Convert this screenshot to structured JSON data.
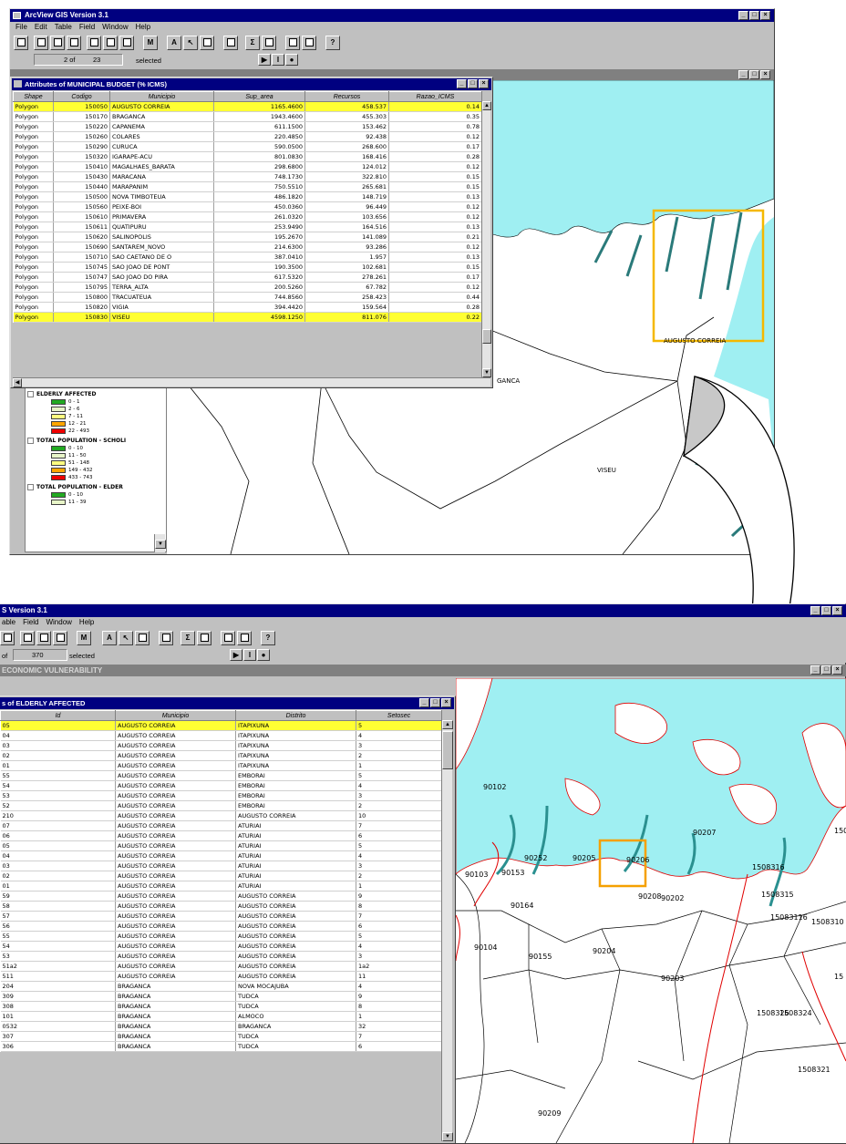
{
  "colors": {
    "title_bar": "#000080",
    "selection": "#ffff33",
    "water": "#9feff2",
    "highlight_box": "#f5b800",
    "map_line_red": "#e00000"
  },
  "top": {
    "app_title": "ArcView GIS Version 3.1",
    "menu": [
      "File",
      "Edit",
      "Table",
      "Field",
      "Window",
      "Help"
    ],
    "status": {
      "selected_count": "2",
      "of_label": "of",
      "total": "23",
      "selected_label": "selected"
    },
    "table": {
      "title": "Attributes of MUNICIPAL BUDGET (% ICMS)",
      "columns": [
        "Shape",
        "Codigo",
        "Municipio",
        "Sup_area",
        "Recursos",
        "Razao_ICMS"
      ],
      "rows": [
        {
          "shape": "Polygon",
          "codigo": "150050",
          "municipio": "AUGUSTO CORREIA",
          "area": "1165.4600",
          "recursos": "458.537",
          "razao": "0.14",
          "sel": true
        },
        {
          "shape": "Polygon",
          "codigo": "150170",
          "municipio": "BRAGANCA",
          "area": "1943.4600",
          "recursos": "455.303",
          "razao": "0.35",
          "sel": false
        },
        {
          "shape": "Polygon",
          "codigo": "150220",
          "municipio": "CAPANEMA",
          "area": "611.1500",
          "recursos": "153.462",
          "razao": "0.78",
          "sel": false
        },
        {
          "shape": "Polygon",
          "codigo": "150260",
          "municipio": "COLARES",
          "area": "220.4850",
          "recursos": "92.438",
          "razao": "0.12",
          "sel": false
        },
        {
          "shape": "Polygon",
          "codigo": "150290",
          "municipio": "CURUCA",
          "area": "590.0500",
          "recursos": "268.600",
          "razao": "0.17",
          "sel": false
        },
        {
          "shape": "Polygon",
          "codigo": "150320",
          "municipio": "IGARAPE-ACU",
          "area": "801.0830",
          "recursos": "168.416",
          "razao": "0.28",
          "sel": false
        },
        {
          "shape": "Polygon",
          "codigo": "150410",
          "municipio": "MAGALHAES_BARATA",
          "area": "298.6800",
          "recursos": "124.012",
          "razao": "0.12",
          "sel": false
        },
        {
          "shape": "Polygon",
          "codigo": "150430",
          "municipio": "MARACANA",
          "area": "748.1730",
          "recursos": "322.810",
          "razao": "0.15",
          "sel": false
        },
        {
          "shape": "Polygon",
          "codigo": "150440",
          "municipio": "MARAPANIM",
          "area": "750.5510",
          "recursos": "265.681",
          "razao": "0.15",
          "sel": false
        },
        {
          "shape": "Polygon",
          "codigo": "150500",
          "municipio": "NOVA TIMBOTEUA",
          "area": "486.1820",
          "recursos": "148.719",
          "razao": "0.13",
          "sel": false
        },
        {
          "shape": "Polygon",
          "codigo": "150560",
          "municipio": "PEIXE-BOI",
          "area": "450.0360",
          "recursos": "96.449",
          "razao": "0.12",
          "sel": false
        },
        {
          "shape": "Polygon",
          "codigo": "150610",
          "municipio": "PRIMAVERA",
          "area": "261.0320",
          "recursos": "103.656",
          "razao": "0.12",
          "sel": false
        },
        {
          "shape": "Polygon",
          "codigo": "150611",
          "municipio": "QUATIPURU",
          "area": "253.9490",
          "recursos": "164.516",
          "razao": "0.13",
          "sel": false
        },
        {
          "shape": "Polygon",
          "codigo": "150620",
          "municipio": "SALINOPOLIS",
          "area": "195.2670",
          "recursos": "141.089",
          "razao": "0.21",
          "sel": false
        },
        {
          "shape": "Polygon",
          "codigo": "150690",
          "municipio": "SANTAREM_NOVO",
          "area": "214.6300",
          "recursos": "93.286",
          "razao": "0.12",
          "sel": false
        },
        {
          "shape": "Polygon",
          "codigo": "150710",
          "municipio": "SAO CAETANO DE O",
          "area": "387.0410",
          "recursos": "1.957",
          "razao": "0.13",
          "sel": false
        },
        {
          "shape": "Polygon",
          "codigo": "150745",
          "municipio": "SAO JOAO DE PONT",
          "area": "190.3500",
          "recursos": "102.681",
          "razao": "0.15",
          "sel": false
        },
        {
          "shape": "Polygon",
          "codigo": "150747",
          "municipio": "SAO JOAO DO PIRA",
          "area": "617.5320",
          "recursos": "278.261",
          "razao": "0.17",
          "sel": false
        },
        {
          "shape": "Polygon",
          "codigo": "150795",
          "municipio": "TERRA_ALTA",
          "area": "200.5260",
          "recursos": "67.782",
          "razao": "0.12",
          "sel": false
        },
        {
          "shape": "Polygon",
          "codigo": "150800",
          "municipio": "TRACUATEUA",
          "area": "744.8560",
          "recursos": "258.423",
          "razao": "0.44",
          "sel": false
        },
        {
          "shape": "Polygon",
          "codigo": "150820",
          "municipio": "VIGIA",
          "area": "394.4420",
          "recursos": "159.564",
          "razao": "0.28",
          "sel": false
        },
        {
          "shape": "Polygon",
          "codigo": "150830",
          "municipio": "VISEU",
          "area": "4598.1250",
          "recursos": "811.076",
          "razao": "0.22",
          "sel": true
        }
      ]
    },
    "legend": {
      "groups": [
        {
          "title": "ELDERLY AFFECTED",
          "items": [
            {
              "label": "0 - 1",
              "color": "#22aa22"
            },
            {
              "label": "2 - 6",
              "color": "#e8f5c8"
            },
            {
              "label": "7 - 11",
              "color": "#ffff80"
            },
            {
              "label": "12 - 21",
              "color": "#ffa500"
            },
            {
              "label": "22 - 493",
              "color": "#ee0000"
            }
          ]
        },
        {
          "title": "TOTAL POPULATION - SCHOLI",
          "items": [
            {
              "label": "0 - 10",
              "color": "#22aa22"
            },
            {
              "label": "11 - 50",
              "color": "#e8f5c8"
            },
            {
              "label": "51 - 148",
              "color": "#ffff80"
            },
            {
              "label": "149 - 432",
              "color": "#ffa500"
            },
            {
              "label": "433 - 743",
              "color": "#ee0000"
            }
          ]
        },
        {
          "title": "TOTAL POPULATION - ELDER",
          "items": [
            {
              "label": "0 - 10",
              "color": "#22aa22"
            },
            {
              "label": "11 - 39",
              "color": "#e8f5c8"
            }
          ]
        }
      ]
    },
    "map_labels": [
      "AUGUSTO CORREIA",
      "VISEU",
      "GANCA"
    ]
  },
  "bottom": {
    "app_title": "S Version 3.1",
    "menu": [
      "able",
      "Field",
      "Window",
      "Help"
    ],
    "status": {
      "of_label": "of",
      "total": "370",
      "selected_label": "selected"
    },
    "view_title": "ECONOMIC VULNERABILITY",
    "table": {
      "title": "s of ELDERLY AFFECTED",
      "columns": [
        "Id",
        "Municipio",
        "Distrito",
        "Setosec"
      ],
      "rows": [
        {
          "id": "05",
          "municipio": "AUGUSTO CORREIA",
          "distrito": "ITAPIXUNA",
          "setor": "5",
          "sel": true
        },
        {
          "id": "04",
          "municipio": "AUGUSTO CORREIA",
          "distrito": "ITAPIXUNA",
          "setor": "4",
          "sel": false
        },
        {
          "id": "03",
          "municipio": "AUGUSTO CORREIA",
          "distrito": "ITAPIXUNA",
          "setor": "3",
          "sel": false
        },
        {
          "id": "02",
          "municipio": "AUGUSTO CORREIA",
          "distrito": "ITAPIXUNA",
          "setor": "2",
          "sel": false
        },
        {
          "id": "01",
          "municipio": "AUGUSTO CORREIA",
          "distrito": "ITAPIXUNA",
          "setor": "1",
          "sel": false
        },
        {
          "id": "55",
          "municipio": "AUGUSTO CORREIA",
          "distrito": "EMBORAI",
          "setor": "5",
          "sel": false
        },
        {
          "id": "54",
          "municipio": "AUGUSTO CORREIA",
          "distrito": "EMBORAI",
          "setor": "4",
          "sel": false
        },
        {
          "id": "53",
          "municipio": "AUGUSTO CORREIA",
          "distrito": "EMBORAI",
          "setor": "3",
          "sel": false
        },
        {
          "id": "52",
          "municipio": "AUGUSTO CORREIA",
          "distrito": "EMBORAI",
          "setor": "2",
          "sel": false
        },
        {
          "id": "210",
          "municipio": "AUGUSTO CORREIA",
          "distrito": "AUGUSTO CORREIA",
          "setor": "10",
          "sel": false
        },
        {
          "id": "07",
          "municipio": "AUGUSTO CORREIA",
          "distrito": "ATURIAI",
          "setor": "7",
          "sel": false
        },
        {
          "id": "06",
          "municipio": "AUGUSTO CORREIA",
          "distrito": "ATURIAI",
          "setor": "6",
          "sel": false
        },
        {
          "id": "05",
          "municipio": "AUGUSTO CORREIA",
          "distrito": "ATURIAI",
          "setor": "5",
          "sel": false
        },
        {
          "id": "04",
          "municipio": "AUGUSTO CORREIA",
          "distrito": "ATURIAI",
          "setor": "4",
          "sel": false
        },
        {
          "id": "03",
          "municipio": "AUGUSTO CORREIA",
          "distrito": "ATURIAI",
          "setor": "3",
          "sel": false
        },
        {
          "id": "02",
          "municipio": "AUGUSTO CORREIA",
          "distrito": "ATURIAI",
          "setor": "2",
          "sel": false
        },
        {
          "id": "01",
          "municipio": "AUGUSTO CORREIA",
          "distrito": "ATURIAI",
          "setor": "1",
          "sel": false
        },
        {
          "id": "59",
          "municipio": "AUGUSTO CORREIA",
          "distrito": "AUGUSTO CORREIA",
          "setor": "9",
          "sel": false
        },
        {
          "id": "58",
          "municipio": "AUGUSTO CORREIA",
          "distrito": "AUGUSTO CORREIA",
          "setor": "8",
          "sel": false
        },
        {
          "id": "57",
          "municipio": "AUGUSTO CORREIA",
          "distrito": "AUGUSTO CORREIA",
          "setor": "7",
          "sel": false
        },
        {
          "id": "56",
          "municipio": "AUGUSTO CORREIA",
          "distrito": "AUGUSTO CORREIA",
          "setor": "6",
          "sel": false
        },
        {
          "id": "55",
          "municipio": "AUGUSTO CORREIA",
          "distrito": "AUGUSTO CORREIA",
          "setor": "5",
          "sel": false
        },
        {
          "id": "54",
          "municipio": "AUGUSTO CORREIA",
          "distrito": "AUGUSTO CORREIA",
          "setor": "4",
          "sel": false
        },
        {
          "id": "53",
          "municipio": "AUGUSTO CORREIA",
          "distrito": "AUGUSTO CORREIA",
          "setor": "3",
          "sel": false
        },
        {
          "id": "51a2",
          "municipio": "AUGUSTO CORREIA",
          "distrito": "AUGUSTO CORREIA",
          "setor": "1a2",
          "sel": false
        },
        {
          "id": "511",
          "municipio": "AUGUSTO CORREIA",
          "distrito": "AUGUSTO CORREIA",
          "setor": "11",
          "sel": false
        },
        {
          "id": "204",
          "municipio": "BRAGANCA",
          "distrito": "NOVA MOCAJUBA",
          "setor": "4",
          "sel": false
        },
        {
          "id": "309",
          "municipio": "BRAGANCA",
          "distrito": "TUDCA",
          "setor": "9",
          "sel": false
        },
        {
          "id": "308",
          "municipio": "BRAGANCA",
          "distrito": "TUDCA",
          "setor": "8",
          "sel": false
        },
        {
          "id": "101",
          "municipio": "BRAGANCA",
          "distrito": "ALMOCO",
          "setor": "1",
          "sel": false
        },
        {
          "id": "0532",
          "municipio": "BRAGANCA",
          "distrito": "BRAGANCA",
          "setor": "32",
          "sel": false
        },
        {
          "id": "307",
          "municipio": "BRAGANCA",
          "distrito": "TUDCA",
          "setor": "7",
          "sel": false
        },
        {
          "id": "306",
          "municipio": "BRAGANCA",
          "distrito": "TUDCA",
          "setor": "6",
          "sel": false
        }
      ]
    },
    "map_labels": [
      "90102",
      "90207",
      "90252",
      "90205",
      "90206",
      "90103",
      "90153",
      "90208",
      "90202",
      "90164",
      "90104",
      "90155",
      "90204",
      "90203",
      "90209",
      "1508316",
      "1508315",
      "15083116",
      "1508310",
      "1508326",
      "1508324",
      "1508321",
      "150",
      "15"
    ]
  }
}
